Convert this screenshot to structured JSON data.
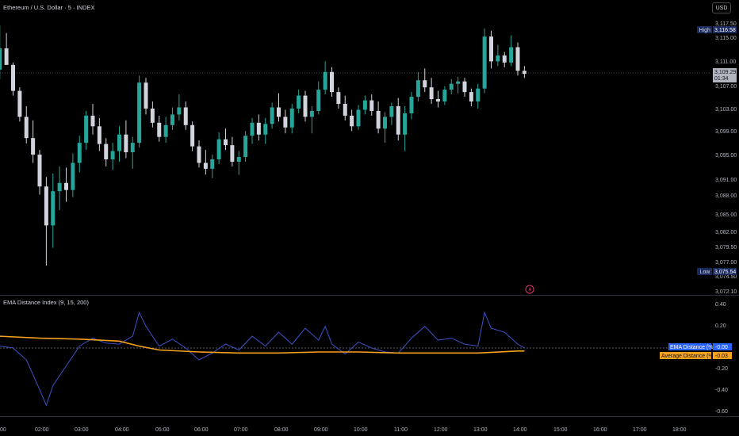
{
  "header": {
    "symbol_title": "Ethereum / U.S. Dollar · 5 · INDEX",
    "currency_button": "USD"
  },
  "indicator": {
    "title": "EMA Distance Index (9, 15, 200)"
  },
  "colors": {
    "up": "#26a69a",
    "down": "#d1d4dc",
    "ema_distance": "#3d52c9",
    "average_distance": "#f5a11b",
    "label_blue": "#2962ff",
    "label_orange": "#f5a11b"
  },
  "price_axis": {
    "ticks": [
      "3,117.50",
      "3,115.00",
      "3,111.00",
      "3,107.00",
      "3,103.00",
      "3,099.00",
      "3,095.00",
      "3,091.00",
      "3,088.00",
      "3,085.00",
      "3,082.00",
      "3,079.50",
      "3,077.00",
      "3,074.50",
      "3,072.10"
    ],
    "high_label": "High",
    "high_value": "3,116.58",
    "low_label": "Low",
    "low_value": "3,075.54",
    "last_price": "3,109.29",
    "countdown": "01:34"
  },
  "indicator_axis": {
    "ticks": [
      "0.40",
      "0.20",
      "-0.20",
      "-0.40",
      "-0.60"
    ],
    "ema_label": "EMA Distance (%)",
    "ema_value": "-0.00",
    "avg_label": "Average Distance (%)",
    "avg_value": "-0.03"
  },
  "time_axis": {
    "ticks": [
      "00",
      "02:00",
      "03:00",
      "04:00",
      "05:00",
      "06:00",
      "07:00",
      "08:00",
      "09:00",
      "10:00",
      "11:00",
      "12:00",
      "13:00",
      "14:00",
      "15:00",
      "16:00",
      "17:00",
      "18:00"
    ]
  },
  "chart_data": [
    {
      "type": "candlestick",
      "title": "Ethereum / U.S. Dollar · 5 · INDEX",
      "ylim": [
        3072.1,
        3117.5
      ],
      "x_range": [
        "01:00",
        "18:30"
      ],
      "grid": false,
      "candles": [
        {
          "t": "01:00",
          "o": 3110.0,
          "h": 3117.5,
          "l": 3108.4,
          "c": 3113.6
        },
        {
          "t": "01:10",
          "o": 3113.6,
          "h": 3116.2,
          "l": 3111.0,
          "c": 3110.8
        },
        {
          "t": "01:20",
          "o": 3110.8,
          "h": 3111.2,
          "l": 3105.6,
          "c": 3106.4
        },
        {
          "t": "01:30",
          "o": 3106.4,
          "h": 3107.0,
          "l": 3101.2,
          "c": 3102.0
        },
        {
          "t": "01:40",
          "o": 3102.0,
          "h": 3103.8,
          "l": 3097.5,
          "c": 3098.4
        },
        {
          "t": "01:50",
          "o": 3098.4,
          "h": 3101.4,
          "l": 3094.2,
          "c": 3095.6
        },
        {
          "t": "02:00",
          "o": 3095.6,
          "h": 3096.4,
          "l": 3088.8,
          "c": 3090.2
        },
        {
          "t": "02:10",
          "o": 3090.2,
          "h": 3091.8,
          "l": 3076.8,
          "c": 3083.6
        },
        {
          "t": "02:20",
          "o": 3083.6,
          "h": 3092.4,
          "l": 3079.8,
          "c": 3089.4
        },
        {
          "t": "02:30",
          "o": 3089.4,
          "h": 3093.6,
          "l": 3086.2,
          "c": 3090.8
        },
        {
          "t": "02:40",
          "o": 3090.8,
          "h": 3093.4,
          "l": 3087.6,
          "c": 3089.6
        },
        {
          "t": "02:50",
          "o": 3089.6,
          "h": 3095.8,
          "l": 3088.4,
          "c": 3094.2
        },
        {
          "t": "03:00",
          "o": 3094.2,
          "h": 3098.8,
          "l": 3092.6,
          "c": 3097.6
        },
        {
          "t": "03:10",
          "o": 3097.6,
          "h": 3103.0,
          "l": 3096.4,
          "c": 3102.2
        },
        {
          "t": "03:20",
          "o": 3102.2,
          "h": 3104.2,
          "l": 3099.0,
          "c": 3100.4
        },
        {
          "t": "03:30",
          "o": 3100.4,
          "h": 3101.8,
          "l": 3096.2,
          "c": 3097.4
        },
        {
          "t": "03:40",
          "o": 3097.4,
          "h": 3098.4,
          "l": 3093.6,
          "c": 3094.8
        },
        {
          "t": "03:50",
          "o": 3094.8,
          "h": 3097.6,
          "l": 3093.0,
          "c": 3096.2
        },
        {
          "t": "04:00",
          "o": 3096.2,
          "h": 3100.4,
          "l": 3094.4,
          "c": 3099.0
        },
        {
          "t": "04:10",
          "o": 3099.0,
          "h": 3101.4,
          "l": 3095.0,
          "c": 3096.0
        },
        {
          "t": "04:20",
          "o": 3096.0,
          "h": 3098.6,
          "l": 3093.2,
          "c": 3097.6
        },
        {
          "t": "04:30",
          "o": 3097.6,
          "h": 3109.0,
          "l": 3096.8,
          "c": 3107.8
        },
        {
          "t": "04:40",
          "o": 3107.8,
          "h": 3108.6,
          "l": 3102.4,
          "c": 3103.4
        },
        {
          "t": "04:50",
          "o": 3103.4,
          "h": 3104.6,
          "l": 3100.2,
          "c": 3101.0
        },
        {
          "t": "05:00",
          "o": 3101.0,
          "h": 3102.2,
          "l": 3097.8,
          "c": 3098.6
        },
        {
          "t": "05:10",
          "o": 3098.6,
          "h": 3102.0,
          "l": 3097.6,
          "c": 3100.6
        },
        {
          "t": "05:20",
          "o": 3100.6,
          "h": 3103.6,
          "l": 3099.8,
          "c": 3102.4
        },
        {
          "t": "05:30",
          "o": 3102.4,
          "h": 3105.8,
          "l": 3101.4,
          "c": 3103.6
        },
        {
          "t": "05:40",
          "o": 3103.6,
          "h": 3104.6,
          "l": 3099.8,
          "c": 3100.6
        },
        {
          "t": "05:50",
          "o": 3100.6,
          "h": 3101.2,
          "l": 3096.2,
          "c": 3097.0
        },
        {
          "t": "06:00",
          "o": 3097.0,
          "h": 3098.0,
          "l": 3093.4,
          "c": 3094.2
        },
        {
          "t": "06:10",
          "o": 3094.2,
          "h": 3096.4,
          "l": 3092.2,
          "c": 3093.2
        },
        {
          "t": "06:20",
          "o": 3093.2,
          "h": 3095.6,
          "l": 3091.6,
          "c": 3094.8
        },
        {
          "t": "06:30",
          "o": 3094.8,
          "h": 3099.4,
          "l": 3094.0,
          "c": 3098.2
        },
        {
          "t": "06:40",
          "o": 3098.2,
          "h": 3100.0,
          "l": 3096.4,
          "c": 3097.2
        },
        {
          "t": "06:50",
          "o": 3097.2,
          "h": 3098.6,
          "l": 3093.6,
          "c": 3094.4
        },
        {
          "t": "07:00",
          "o": 3094.4,
          "h": 3096.2,
          "l": 3092.2,
          "c": 3095.2
        },
        {
          "t": "07:10",
          "o": 3095.2,
          "h": 3099.6,
          "l": 3094.4,
          "c": 3098.8
        },
        {
          "t": "07:20",
          "o": 3098.8,
          "h": 3101.8,
          "l": 3097.4,
          "c": 3101.0
        },
        {
          "t": "07:30",
          "o": 3101.0,
          "h": 3102.4,
          "l": 3098.0,
          "c": 3099.0
        },
        {
          "t": "07:40",
          "o": 3099.0,
          "h": 3101.8,
          "l": 3097.4,
          "c": 3100.8
        },
        {
          "t": "07:50",
          "o": 3100.8,
          "h": 3104.4,
          "l": 3100.0,
          "c": 3103.6
        },
        {
          "t": "08:00",
          "o": 3103.6,
          "h": 3106.0,
          "l": 3101.2,
          "c": 3102.0
        },
        {
          "t": "08:10",
          "o": 3102.0,
          "h": 3103.2,
          "l": 3099.2,
          "c": 3100.2
        },
        {
          "t": "08:20",
          "o": 3100.2,
          "h": 3104.2,
          "l": 3099.2,
          "c": 3103.4
        },
        {
          "t": "08:30",
          "o": 3103.4,
          "h": 3106.6,
          "l": 3102.6,
          "c": 3105.6
        },
        {
          "t": "08:40",
          "o": 3105.6,
          "h": 3106.4,
          "l": 3101.2,
          "c": 3102.0
        },
        {
          "t": "08:50",
          "o": 3102.0,
          "h": 3103.8,
          "l": 3099.2,
          "c": 3103.0
        },
        {
          "t": "09:00",
          "o": 3103.0,
          "h": 3108.0,
          "l": 3102.4,
          "c": 3106.6
        },
        {
          "t": "09:10",
          "o": 3106.6,
          "h": 3111.4,
          "l": 3105.8,
          "c": 3109.6
        },
        {
          "t": "09:20",
          "o": 3109.6,
          "h": 3110.4,
          "l": 3105.4,
          "c": 3106.2
        },
        {
          "t": "09:30",
          "o": 3106.2,
          "h": 3107.0,
          "l": 3103.4,
          "c": 3104.2
        },
        {
          "t": "09:40",
          "o": 3104.2,
          "h": 3105.6,
          "l": 3101.4,
          "c": 3102.2
        },
        {
          "t": "09:50",
          "o": 3102.2,
          "h": 3103.2,
          "l": 3099.6,
          "c": 3100.4
        },
        {
          "t": "10:00",
          "o": 3100.4,
          "h": 3104.0,
          "l": 3099.8,
          "c": 3103.2
        },
        {
          "t": "10:10",
          "o": 3103.2,
          "h": 3105.6,
          "l": 3102.4,
          "c": 3104.8
        },
        {
          "t": "10:20",
          "o": 3104.8,
          "h": 3105.8,
          "l": 3102.2,
          "c": 3103.0
        },
        {
          "t": "10:30",
          "o": 3103.0,
          "h": 3104.6,
          "l": 3099.2,
          "c": 3100.0
        },
        {
          "t": "10:40",
          "o": 3100.0,
          "h": 3102.8,
          "l": 3097.6,
          "c": 3102.0
        },
        {
          "t": "10:50",
          "o": 3102.0,
          "h": 3104.4,
          "l": 3100.6,
          "c": 3103.8
        },
        {
          "t": "11:00",
          "o": 3103.8,
          "h": 3105.2,
          "l": 3098.0,
          "c": 3099.0
        },
        {
          "t": "11:10",
          "o": 3099.0,
          "h": 3103.8,
          "l": 3096.2,
          "c": 3102.6
        },
        {
          "t": "11:20",
          "o": 3102.6,
          "h": 3106.2,
          "l": 3101.6,
          "c": 3105.4
        },
        {
          "t": "11:30",
          "o": 3105.4,
          "h": 3109.6,
          "l": 3104.6,
          "c": 3108.2
        },
        {
          "t": "11:40",
          "o": 3108.2,
          "h": 3110.2,
          "l": 3106.2,
          "c": 3107.0
        },
        {
          "t": "11:50",
          "o": 3107.0,
          "h": 3108.6,
          "l": 3104.2,
          "c": 3105.0
        },
        {
          "t": "12:00",
          "o": 3105.0,
          "h": 3106.4,
          "l": 3103.6,
          "c": 3104.6
        },
        {
          "t": "12:10",
          "o": 3104.6,
          "h": 3107.2,
          "l": 3104.0,
          "c": 3106.6
        },
        {
          "t": "12:20",
          "o": 3106.6,
          "h": 3108.4,
          "l": 3105.8,
          "c": 3107.6
        },
        {
          "t": "12:30",
          "o": 3107.6,
          "h": 3108.8,
          "l": 3106.0,
          "c": 3108.0
        },
        {
          "t": "12:40",
          "o": 3108.0,
          "h": 3108.6,
          "l": 3105.4,
          "c": 3106.2
        },
        {
          "t": "12:50",
          "o": 3106.2,
          "h": 3106.8,
          "l": 3103.8,
          "c": 3104.6
        },
        {
          "t": "13:00",
          "o": 3104.6,
          "h": 3107.6,
          "l": 3103.4,
          "c": 3106.8
        },
        {
          "t": "13:10",
          "o": 3106.8,
          "h": 3117.0,
          "l": 3106.0,
          "c": 3115.6
        },
        {
          "t": "13:20",
          "o": 3115.6,
          "h": 3116.6,
          "l": 3110.2,
          "c": 3111.4
        },
        {
          "t": "13:30",
          "o": 3111.4,
          "h": 3114.2,
          "l": 3110.6,
          "c": 3112.4
        },
        {
          "t": "13:40",
          "o": 3112.4,
          "h": 3113.0,
          "l": 3110.4,
          "c": 3111.2
        },
        {
          "t": "13:50",
          "o": 3111.2,
          "h": 3115.8,
          "l": 3110.6,
          "c": 3113.8
        },
        {
          "t": "14:00",
          "o": 3113.8,
          "h": 3114.6,
          "l": 3109.0,
          "c": 3109.8
        },
        {
          "t": "14:10",
          "o": 3109.8,
          "h": 3110.6,
          "l": 3108.6,
          "c": 3109.29
        }
      ]
    },
    {
      "type": "line",
      "title": "EMA Distance Index (9, 15, 200)",
      "ylim": [
        -0.65,
        0.45
      ],
      "series": [
        {
          "name": "EMA Distance (%)",
          "color": "#3d52c9",
          "x": [
            "01:00",
            "01:20",
            "01:40",
            "02:00",
            "02:10",
            "02:20",
            "02:40",
            "03:00",
            "03:20",
            "03:40",
            "04:00",
            "04:20",
            "04:30",
            "04:40",
            "05:00",
            "05:20",
            "05:40",
            "06:00",
            "06:20",
            "06:40",
            "07:00",
            "07:20",
            "07:40",
            "08:00",
            "08:20",
            "08:40",
            "09:00",
            "09:10",
            "09:20",
            "09:40",
            "10:00",
            "10:20",
            "10:40",
            "11:00",
            "11:20",
            "11:40",
            "12:00",
            "12:20",
            "12:40",
            "13:00",
            "13:10",
            "13:20",
            "13:40",
            "14:00",
            "14:10"
          ],
          "values": [
            0.02,
            0.0,
            -0.12,
            -0.42,
            -0.58,
            -0.38,
            -0.18,
            0.02,
            0.1,
            0.05,
            0.04,
            0.12,
            0.36,
            0.22,
            0.02,
            0.09,
            0.0,
            -0.12,
            -0.05,
            0.04,
            -0.02,
            0.12,
            0.02,
            0.16,
            0.04,
            0.2,
            0.08,
            0.22,
            0.04,
            -0.06,
            0.06,
            0.0,
            -0.04,
            -0.05,
            0.1,
            0.22,
            0.08,
            0.1,
            0.04,
            0.02,
            0.36,
            0.2,
            0.16,
            0.04,
            0.0
          ]
        },
        {
          "name": "Average Distance (%)",
          "color": "#f5a11b",
          "x": [
            "01:00",
            "02:00",
            "03:00",
            "04:00",
            "04:30",
            "05:00",
            "06:00",
            "07:00",
            "08:00",
            "09:00",
            "10:00",
            "11:00",
            "12:00",
            "13:00",
            "14:00",
            "14:10"
          ],
          "values": [
            0.12,
            0.1,
            0.09,
            0.07,
            0.02,
            -0.02,
            -0.04,
            -0.05,
            -0.05,
            -0.04,
            -0.04,
            -0.05,
            -0.05,
            -0.05,
            -0.03,
            -0.03
          ]
        }
      ]
    }
  ]
}
